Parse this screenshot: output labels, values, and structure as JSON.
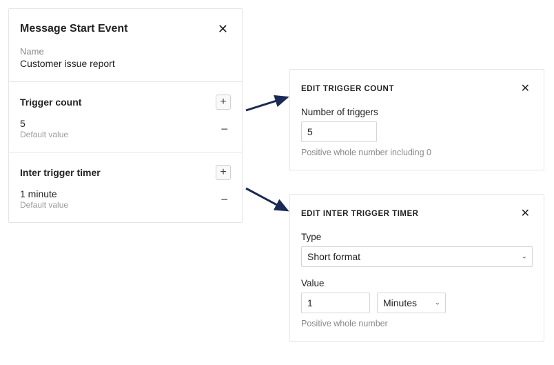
{
  "header": {
    "title": "Message Start Event",
    "name_label": "Name",
    "name_value": "Customer issue report"
  },
  "trigger_count": {
    "title": "Trigger count",
    "value": "5",
    "default_label": "Default value"
  },
  "inter_trigger": {
    "title": "Inter trigger timer",
    "value": "1 minute",
    "default_label": "Default value"
  },
  "edit_count": {
    "title": "EDIT TRIGGER COUNT",
    "field_label": "Number of triggers",
    "value": "5",
    "helper": "Positive whole number including 0"
  },
  "edit_timer": {
    "title": "EDIT INTER TRIGGER TIMER",
    "type_label": "Type",
    "type_value": "Short format",
    "value_label": "Value",
    "value": "1",
    "unit": "Minutes",
    "helper": "Positive whole number"
  }
}
